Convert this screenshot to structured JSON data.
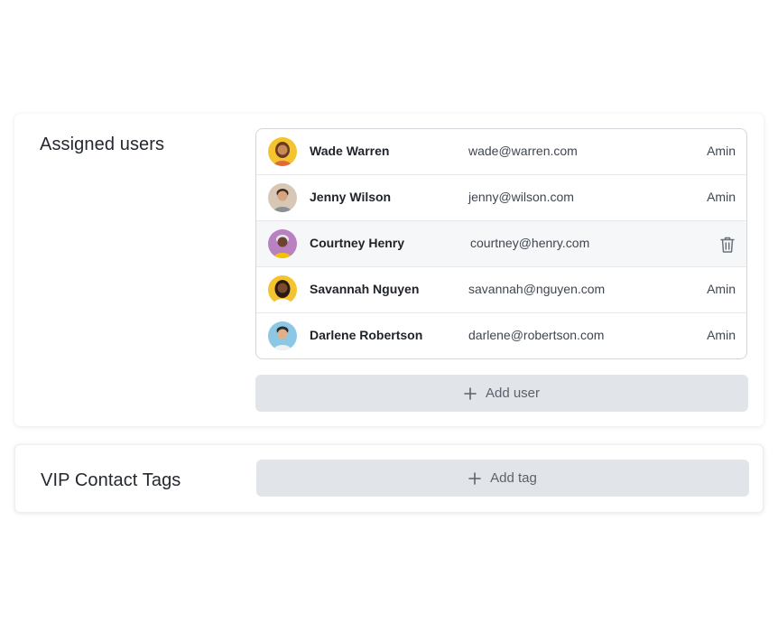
{
  "assigned_users": {
    "title": "Assigned users",
    "users": [
      {
        "name": "Wade Warren",
        "email": "wade@warren.com",
        "role": "Amin",
        "avatar_bg": "#f4c430",
        "skin": "#c98a5a",
        "hair": "#6b3b1f",
        "shirt": "#e06a3b"
      },
      {
        "name": "Jenny Wilson",
        "email": "jenny@wilson.com",
        "role": "Amin",
        "avatar_bg": "#d9c7b5",
        "skin": "#d8a47f",
        "hair": "#3a2a20",
        "shirt": "#8a8f96"
      },
      {
        "name": "Courtney Henry",
        "email": "courtney@henry.com",
        "role": "",
        "avatar_bg": "#b980c2",
        "skin": "#6b4330",
        "hair": "#e8e8e8",
        "shirt": "#f2c400"
      },
      {
        "name": "Savannah Nguyen",
        "email": "savannah@nguyen.com",
        "role": "Amin",
        "avatar_bg": "#f4c430",
        "skin": "#7a4a2c",
        "hair": "#2a1a10",
        "shirt": "#ffffff"
      },
      {
        "name": "Darlene Robertson",
        "email": "darlene@robertson.com",
        "role": "Amin",
        "avatar_bg": "#8cc8e6",
        "skin": "#e0b08a",
        "hair": "#2b2b2b",
        "shirt": "#f0f0f0"
      }
    ],
    "hovered_row_index": 2,
    "add_user_label": "Add user"
  },
  "vip_tags": {
    "title": "VIP Contact Tags",
    "add_tag_label": "Add tag"
  },
  "icons": {
    "add": "plus-icon",
    "delete": "trash-icon"
  }
}
